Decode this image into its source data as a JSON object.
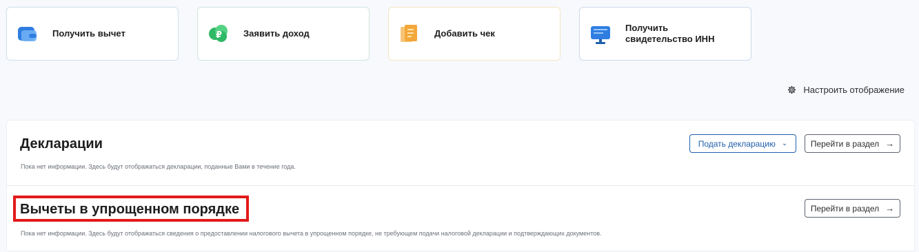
{
  "cards": [
    {
      "label": "Получить вычет",
      "icon": "wallet-icon",
      "accent": "#2f7de1"
    },
    {
      "label": "Заявить доход",
      "icon": "ruble-cloud-icon",
      "accent": "#2fb865"
    },
    {
      "label": "Добавить чек",
      "icon": "receipt-icon",
      "accent": "#f2a83a"
    },
    {
      "label": "Получить свидетельство ИНН",
      "icon": "monitor-icon",
      "accent": "#2f7de1"
    }
  ],
  "settings": {
    "label": "Настроить отображение",
    "icon": "gear-icon"
  },
  "declarations": {
    "title": "Декларации",
    "description": "Пока нет информации. Здесь будут отображаться декларации, поданные Вами в течение года.",
    "submit_button": "Подать декларацию",
    "goto_button": "Перейти в раздел"
  },
  "deductions": {
    "title": "Вычеты в упрощенном порядке",
    "description": "Пока нет информации. Здесь будут отображаться сведения о предоставлении налогового вычета в упрощенном порядке, не требующем подачи налоговой декларации и подтверждающих документов.",
    "goto_button": "Перейти в раздел",
    "highlight_color": "#e21a1a"
  }
}
